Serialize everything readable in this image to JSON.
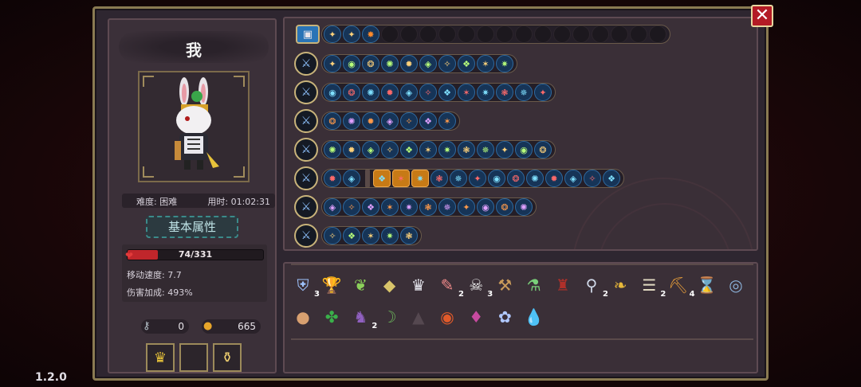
{
  "player": {
    "name": "我",
    "difficulty": "难度: 困难",
    "playtime": "用时: 01:02:31"
  },
  "attributes": {
    "title": "基本属性",
    "hp_text": "74/331",
    "hp_fraction": 0.2236,
    "move_speed": "移动速度: 7.7",
    "damage_bonus": "伤害加成: 493%"
  },
  "currency": {
    "keys": "0",
    "coins": "665"
  },
  "slots": [
    "golden-crown",
    "",
    "flask"
  ],
  "top_strip": {
    "first_icon": "treasure-chest-icon",
    "chips": [
      "butterfly",
      "butterfly",
      "spark"
    ],
    "empty_count": 15
  },
  "weapon_rows": [
    {
      "weapon": "crystal-sword-icon",
      "chips": 10
    },
    {
      "weapon": "staff-icon",
      "chips": 12
    },
    {
      "weapon": "dagger-icon",
      "chips": 7
    },
    {
      "weapon": "katana-icon",
      "chips": 12
    },
    {
      "weapon": "dark-staff-icon",
      "chips": 16
    },
    {
      "weapon": "spear-icon",
      "chips": 11
    },
    {
      "weapon": "orb-icon",
      "chips": 5
    }
  ],
  "items_row1": [
    {
      "name": "shield-charm",
      "count": "3"
    },
    {
      "name": "golden-chalice",
      "count": ""
    },
    {
      "name": "leaf-dagger",
      "count": ""
    },
    {
      "name": "emerald-rune",
      "count": ""
    },
    {
      "name": "silver-mask",
      "count": ""
    },
    {
      "name": "feather-quill",
      "count": "2"
    },
    {
      "name": "fang-necklace",
      "count": "3"
    },
    {
      "name": "wrench",
      "count": ""
    },
    {
      "name": "green-syringe",
      "count": ""
    },
    {
      "name": "wizard-hat",
      "count": ""
    },
    {
      "name": "magnifier",
      "count": "2"
    },
    {
      "name": "golden-wings",
      "count": ""
    },
    {
      "name": "ribcage",
      "count": "2"
    },
    {
      "name": "pickaxe",
      "count": "4"
    },
    {
      "name": "hourglass",
      "count": ""
    },
    {
      "name": "clock-amulet",
      "count": ""
    }
  ],
  "items_row2": [
    {
      "name": "cookie",
      "count": ""
    },
    {
      "name": "four-leaf-clover",
      "count": ""
    },
    {
      "name": "purple-cloak",
      "count": "2"
    },
    {
      "name": "green-boomerang",
      "count": ""
    },
    {
      "name": "dark-robe",
      "count": ""
    },
    {
      "name": "fire-eye",
      "count": ""
    },
    {
      "name": "rainbow-shield",
      "count": ""
    },
    {
      "name": "lotus",
      "count": ""
    },
    {
      "name": "water-drop",
      "count": ""
    }
  ],
  "ui": {
    "close": "✕",
    "version": "1.2.0"
  }
}
